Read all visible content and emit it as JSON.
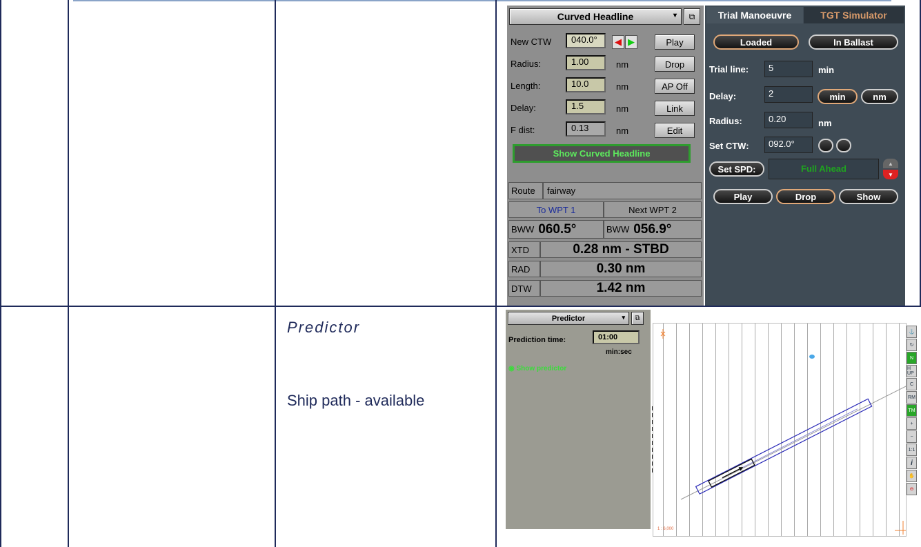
{
  "curved": {
    "title": "Curved Headline",
    "rows": [
      {
        "label": "New CTW",
        "value": "040.0°",
        "unit": ""
      },
      {
        "label": "Radius:",
        "value": "1.00",
        "unit": "nm"
      },
      {
        "label": "Length:",
        "value": "10.0",
        "unit": "nm"
      },
      {
        "label": "Delay:",
        "value": "1.5",
        "unit": "nm"
      },
      {
        "label": "F dist:",
        "value": "0.13",
        "unit": "nm"
      }
    ],
    "buttons": {
      "play": "Play",
      "drop": "Drop",
      "ap_off": "AP Off",
      "link": "Link",
      "edit": "Edit"
    },
    "show_label": "Show Curved Headline",
    "route_label": "Route",
    "route_value": "fairway",
    "to_wpt": "To WPT 1",
    "next_wpt": "Next WPT 2",
    "bww_label": "BWW",
    "bww1": "060.5°",
    "bww2": "056.9°",
    "xtd_label": "XTD",
    "xtd": "0.28 nm - STBD",
    "rad_label": "RAD",
    "rad": "0.30 nm",
    "dtw_label": "DTW",
    "dtw": "1.42 nm"
  },
  "trial": {
    "tab_active": "Trial Manoeuvre",
    "tab_inactive": "TGT Simulator",
    "loaded": "Loaded",
    "ballast": "In Ballast",
    "trial_line_label": "Trial line:",
    "trial_line_value": "5",
    "trial_line_unit": "min",
    "delay_label": "Delay:",
    "delay_value": "2",
    "min_btn": "min",
    "nm_btn": "nm",
    "radius_label": "Radius:",
    "radius_value": "0.20",
    "radius_unit": "nm",
    "setctw_label": "Set CTW:",
    "setctw_value": "092.0°",
    "setspd_label": "Set SPD:",
    "setspd_value": "Full Ahead",
    "play": "Play",
    "drop": "Drop",
    "show": "Show"
  },
  "doc": {
    "predictor_heading": "Predictor",
    "ship_path": "Ship path - available"
  },
  "predictor": {
    "title": "Predictor",
    "time_label": "Prediction time:",
    "time_value": "01:00",
    "time_unit": "min:sec",
    "show_label": "Show predictor",
    "scale": "1 : 6,000"
  },
  "toolbar": [
    "H UP",
    "RM",
    "TM",
    "1:1",
    "i"
  ]
}
